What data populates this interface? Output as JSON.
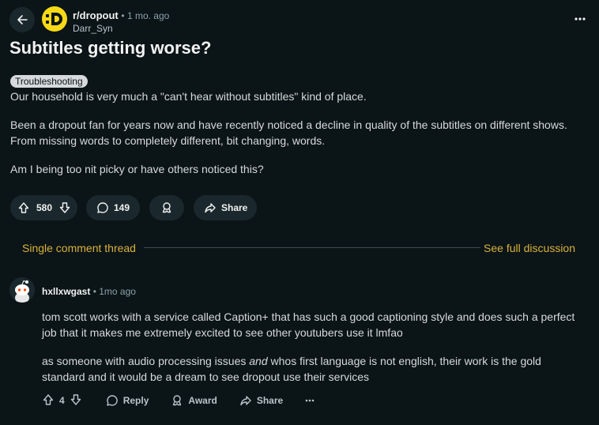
{
  "post": {
    "subreddit": "r/dropout",
    "time": "1 mo. ago",
    "author": "Darr_Syn",
    "title": "Subtitles getting worse?",
    "flair": "Troubleshooting",
    "paragraphs": [
      "Our household is very much a \"can't hear without subtitles\" kind of place.",
      "Been a dropout fan for years now and have recently noticed a decline in quality of the subtitles on different shows. From missing words to completely different, bit changing, words.",
      "Am I being too nit picky or have others noticed this?"
    ],
    "votes": "580",
    "comments": "149",
    "share_label": "Share"
  },
  "thread": {
    "label": "Single comment thread",
    "see_full": "See full discussion"
  },
  "comment": {
    "author": "hxllxwgast",
    "time": "1mo ago",
    "p1": "tom scott works with a service called Caption+ that has such a good captioning style and does such a perfect job that it makes me extremely excited to see other youtubers use it lmfao",
    "p2_before": "as someone with audio processing issues ",
    "p2_em": "and",
    "p2_after": " whos first language is not english, their work is the gold standard and it would be a dream to see dropout use their services",
    "votes": "4",
    "reply": "Reply",
    "award": "Award",
    "share": "Share"
  },
  "colors": {
    "background": "#0b1416",
    "accent_gold": "#d9b23c",
    "subreddit_yellow": "#f7d917"
  },
  "icons": [
    "back-arrow-icon",
    "subreddit-icon",
    "more-icon",
    "upvote-icon",
    "downvote-icon",
    "comment-icon",
    "award-icon",
    "share-icon"
  ]
}
